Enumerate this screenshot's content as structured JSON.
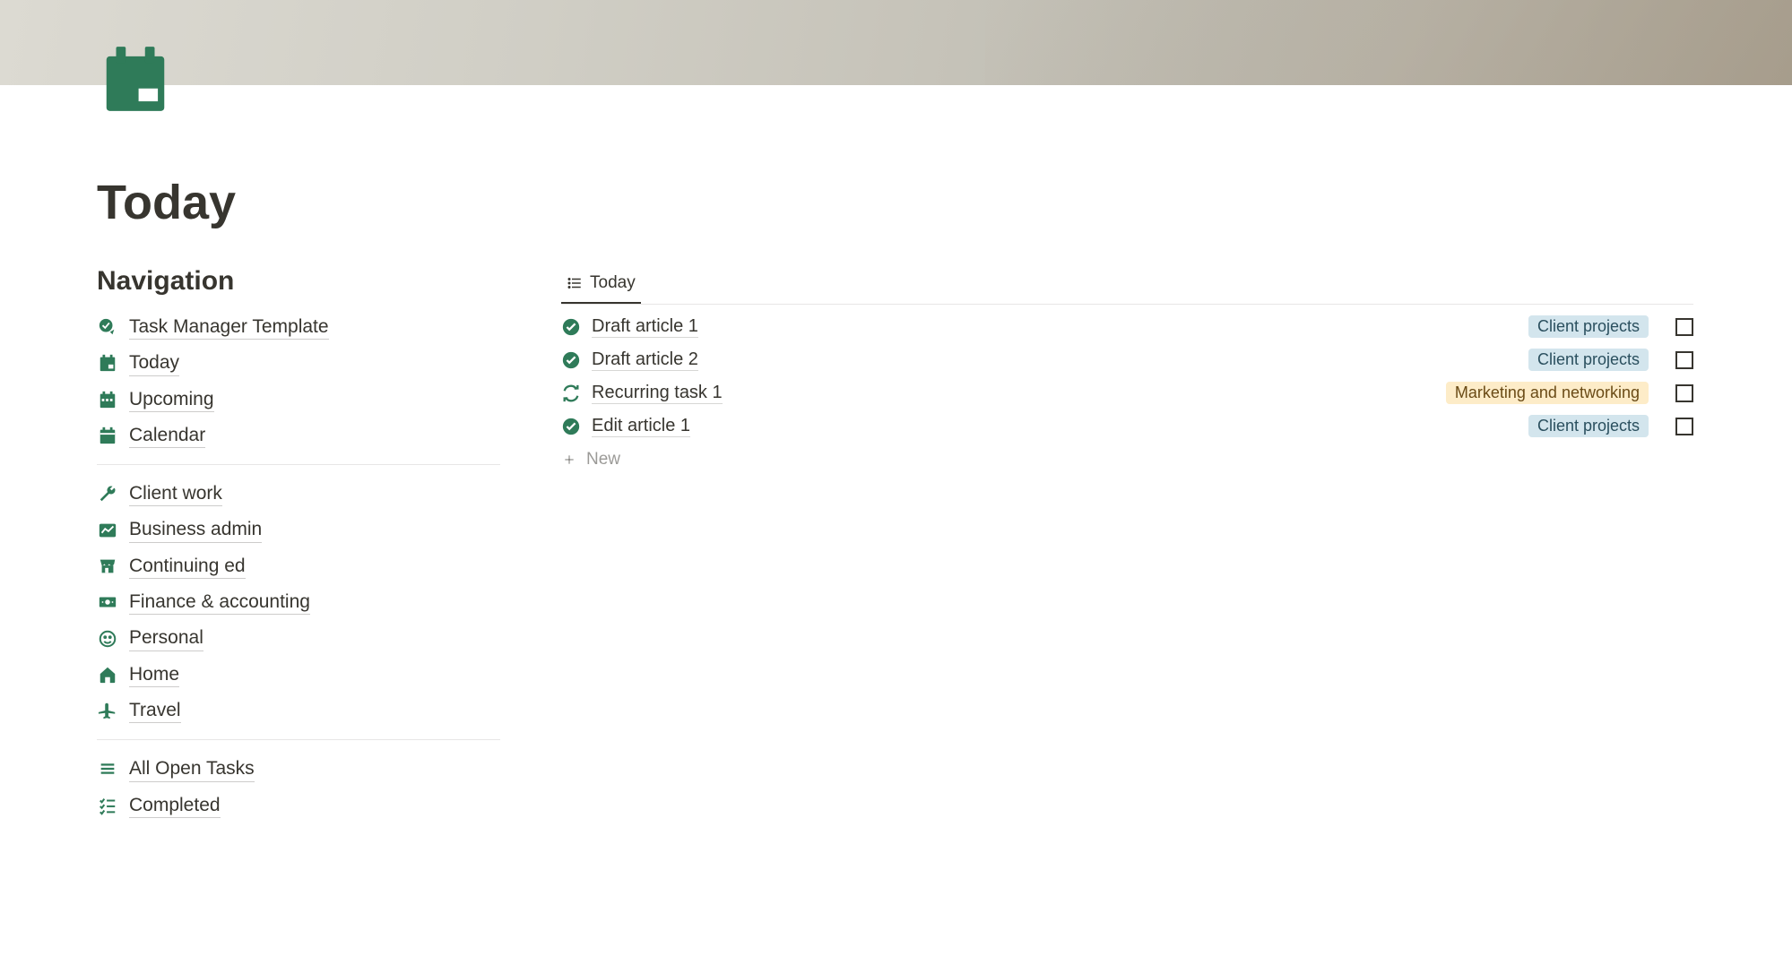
{
  "page": {
    "title": "Today"
  },
  "sidebar": {
    "heading": "Navigation",
    "sections": [
      [
        {
          "icon": "check-arrow",
          "label": "Task Manager Template"
        },
        {
          "icon": "calendar-day",
          "label": "Today"
        },
        {
          "icon": "calendar-week",
          "label": "Upcoming"
        },
        {
          "icon": "calendar",
          "label": "Calendar"
        }
      ],
      [
        {
          "icon": "wrench",
          "label": "Client work"
        },
        {
          "icon": "chart",
          "label": "Business admin"
        },
        {
          "icon": "store",
          "label": "Continuing ed"
        },
        {
          "icon": "money",
          "label": "Finance & accounting"
        },
        {
          "icon": "face",
          "label": "Personal"
        },
        {
          "icon": "home",
          "label": "Home"
        },
        {
          "icon": "plane",
          "label": "Travel"
        }
      ],
      [
        {
          "icon": "list-lines",
          "label": "All Open Tasks"
        },
        {
          "icon": "checklist",
          "label": "Completed"
        }
      ]
    ]
  },
  "tabs": [
    {
      "label": "Today",
      "active": true
    }
  ],
  "tasks": [
    {
      "icon": "check-circle",
      "title": "Draft article 1",
      "tag": "Client projects",
      "tagColor": "blue"
    },
    {
      "icon": "check-circle",
      "title": "Draft article 2",
      "tag": "Client projects",
      "tagColor": "blue"
    },
    {
      "icon": "repeat",
      "title": "Recurring task 1",
      "tag": "Marketing and networking",
      "tagColor": "yellow"
    },
    {
      "icon": "check-circle",
      "title": "Edit article 1",
      "tag": "Client projects",
      "tagColor": "blue"
    }
  ],
  "newRow": {
    "label": "New"
  }
}
